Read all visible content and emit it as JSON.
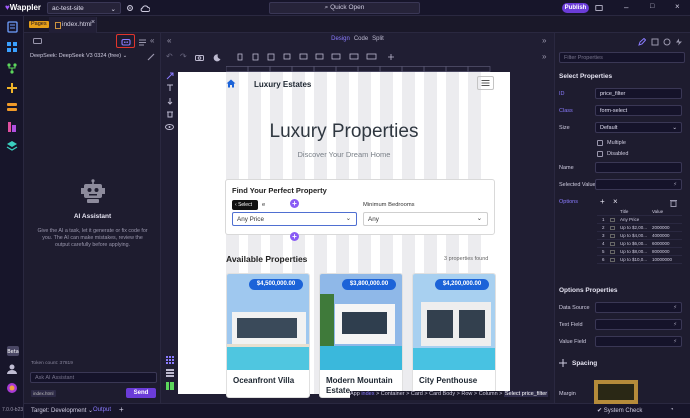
{
  "app": {
    "logo": "Wappler",
    "project": "ac-test-site",
    "quick_open": "Quick Open",
    "publish": "Publish",
    "version": "7.0.0-b23"
  },
  "tabs": {
    "pages_tag": "Pages",
    "file": "index.html"
  },
  "ai": {
    "model": "DeepSeek: DeepSeek V3 0324 (free)",
    "title": "AI Assistant",
    "description": "Give the AI a task, let it generate or fix code for you. The AI can make mistakes, review the output carefully before applying.",
    "token_count": "Token count: 37819",
    "input_placeholder": "Ask AI Assistant",
    "file_tag": "index.html",
    "send": "Send"
  },
  "design": {
    "tabs": [
      "Design",
      "Code",
      "Split"
    ],
    "active_tab": "Design"
  },
  "page": {
    "brand": "Luxury Estates",
    "hero_title": "Luxury Properties",
    "hero_subtitle": "Discover Your Dream Home",
    "card_title": "Find Your Perfect Property",
    "min_bedrooms": "Minimum Bedrooms",
    "price_select": "Any Price",
    "bed_select": "Any",
    "select_tooltip": "Select",
    "available": "Available Properties",
    "found": "3 properties found",
    "properties": [
      {
        "price": "$4,500,000.00",
        "title": "Oceanfront Villa"
      },
      {
        "price": "$3,800,000.00",
        "title": "Modern Mountain Estate"
      },
      {
        "price": "$4,200,000.00",
        "title": "City Penthouse"
      }
    ]
  },
  "breadcrumb": [
    "App",
    "index",
    "Container",
    "Card",
    "Card Body",
    "Row",
    "Column",
    "Select price_filter"
  ],
  "status": {
    "target": "Target: Development",
    "output": "Output",
    "system_check": "System Check"
  },
  "props": {
    "filter_placeholder": "Filter Properties",
    "section_select": "Select Properties",
    "id_label": "ID",
    "id_value": "price_filter",
    "class_label": "Class",
    "class_value": "form-select",
    "size_label": "Size",
    "size_value": "Default",
    "multiple": "Multiple",
    "disabled": "Disabled",
    "name_label": "Name",
    "selected_label": "Selected Value",
    "options_label": "Options",
    "opt_head_title": "Title",
    "opt_head_value": "Value",
    "options": [
      {
        "n": "1",
        "title": "Any Price",
        "value": ""
      },
      {
        "n": "2",
        "title": "Up to $2,00...",
        "value": "2000000"
      },
      {
        "n": "3",
        "title": "Up to $4,00...",
        "value": "4000000"
      },
      {
        "n": "4",
        "title": "Up to $6,00...",
        "value": "6000000"
      },
      {
        "n": "5",
        "title": "Up to $8,00...",
        "value": "8000000"
      },
      {
        "n": "6",
        "title": "Up to $10,0...",
        "value": "10000000"
      }
    ],
    "section_options": "Options Properties",
    "datasource": "Data Source",
    "textfield": "Text Field",
    "valuefield": "Value Field",
    "spacing": "Spacing",
    "margin": "Margin"
  },
  "colors": {
    "accent": "#6b3cd8",
    "price_badge": "#1c63d8",
    "highlight": "#e0352c"
  }
}
